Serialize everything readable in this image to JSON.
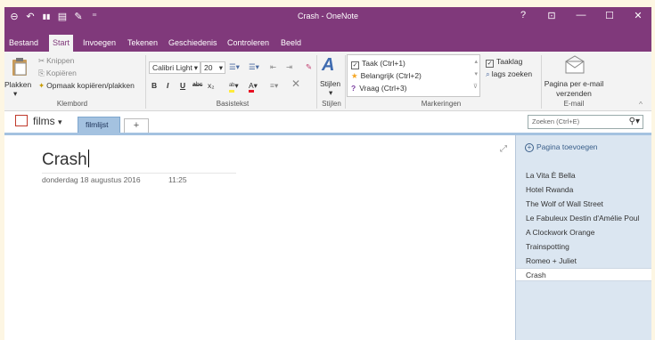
{
  "window": {
    "title": "Crash - OneNote",
    "controls": {
      "help": "?",
      "ribbon_options": "⊡",
      "minimize": "—",
      "maximize": "☐",
      "close": "✕"
    }
  },
  "quick_access": {
    "back": "⊖",
    "undo": "↶",
    "dock": "▮▮",
    "view": "▤",
    "pen": "✎",
    "more": "⁼"
  },
  "ribbon_tabs": [
    "Bestand",
    "Start",
    "Invoegen",
    "Tekenen",
    "Geschiedenis",
    "Controleren",
    "Beeld"
  ],
  "ribbon": {
    "clipboard": {
      "paste": "Plakken",
      "cut": "Knippen",
      "copy": "Kopiëren",
      "format_painter": "Opmaak kopiëren/plakken",
      "group": "Klembord"
    },
    "basic_text": {
      "font": "Calibri Light",
      "size": "20",
      "bold": "B",
      "italic": "I",
      "underline": "U",
      "strike": "abc",
      "subscript": "x₂",
      "group": "Basistekst"
    },
    "styles": {
      "label": "Stijlen",
      "group": "Stijlen"
    },
    "tags": {
      "items": [
        "Taak (Ctrl+1)",
        "Belangrijk (Ctrl+2)",
        "Vraag (Ctrl+3)"
      ],
      "todo_tag": "Taaklag",
      "find_tags": "lags zoeken",
      "group": "Markeringen"
    },
    "email": {
      "label": "Pagina per e-mail verzenden",
      "group": "E-mail"
    }
  },
  "notebook": {
    "name": "films",
    "section": "filmlijst",
    "add_section": "+",
    "search_placeholder": "Zoeken (Ctrl+E)"
  },
  "page": {
    "title": "Crash",
    "date": "donderdag 18 augustus 2016",
    "time": "11:25"
  },
  "page_list": {
    "add_page": "Pagina toevoegen",
    "pages": [
      "La Vita È Bella",
      "Hotel Rwanda",
      "The Wolf of Wall Street",
      "Le Fabuleux Destin d'Amélie Poul",
      "A Clockwork Orange",
      "Trainspotting",
      "Romeo + Juliet",
      "Crash"
    ],
    "selected_index": 7
  },
  "colors": {
    "accent": "#80397b",
    "section": "#a4c2e0",
    "page_pane": "#dbe6f1"
  }
}
